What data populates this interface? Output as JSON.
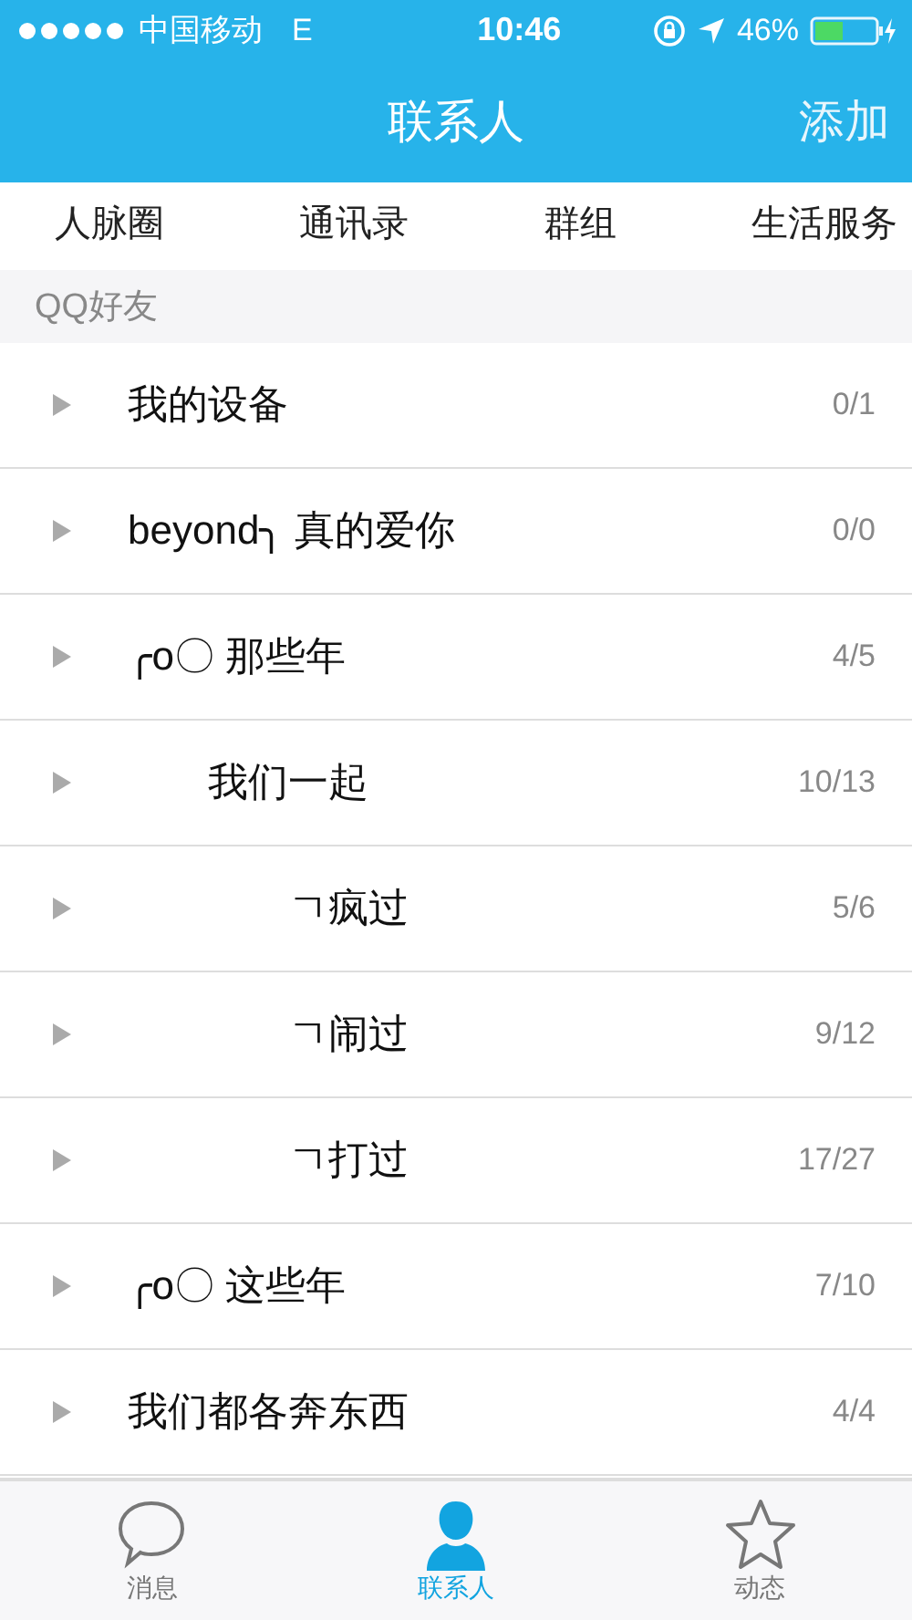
{
  "status_bar": {
    "carrier": "中国移动",
    "network": "E",
    "time": "10:46",
    "battery": "46%"
  },
  "nav_bar": {
    "title": "联系人",
    "action": "添加"
  },
  "segments": [
    {
      "label": "人脉圈",
      "selected": false
    },
    {
      "label": "通讯录",
      "selected": false
    },
    {
      "label": "群组",
      "selected": false
    },
    {
      "label": "生活服务",
      "selected": false
    }
  ],
  "section_header": "QQ好友",
  "groups": [
    {
      "name": "我的设备",
      "count": "0/1",
      "expanded": false
    },
    {
      "name": "beyond╮ 真的爱你",
      "count": "0/0",
      "expanded": false
    },
    {
      "name": "╭o〇 那些年",
      "count": "4/5",
      "expanded": false
    },
    {
      "name": "　　我们一起",
      "count": "10/13",
      "expanded": false
    },
    {
      "name": "　　　　ㄱ疯过",
      "count": "5/6",
      "expanded": false
    },
    {
      "name": "　　　　ㄱ闹过",
      "count": "9/12",
      "expanded": false
    },
    {
      "name": "　　　　ㄱ打过",
      "count": "17/27",
      "expanded": false
    },
    {
      "name": "╭o〇 这些年",
      "count": "7/10",
      "expanded": false
    },
    {
      "name": "我们都各奔东西",
      "count": "4/4",
      "expanded": false
    }
  ],
  "tab_bar": [
    {
      "label": "消息",
      "kind": "chat",
      "selected": false
    },
    {
      "label": "联系人",
      "kind": "contact",
      "selected": true
    },
    {
      "label": "动态",
      "kind": "star",
      "selected": false
    }
  ]
}
